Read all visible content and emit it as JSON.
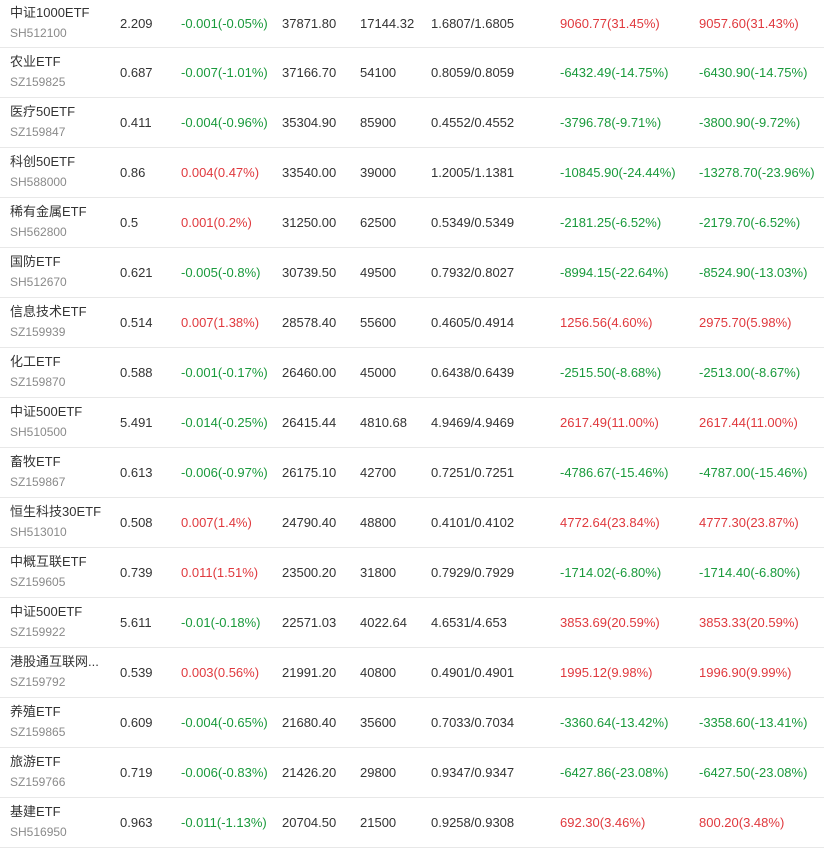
{
  "colors": {
    "up": "#e0393e",
    "down": "#1a9a3c"
  },
  "rows": [
    {
      "name": "中证1000ETF",
      "code": "SH512100",
      "price": "2.209",
      "change": "-0.001(-0.05%)",
      "change_dir": "down",
      "amount": "37871.80",
      "shares": "17144.32",
      "nav": "1.6807/1.6805",
      "pnl1": "9060.77(31.45%)",
      "pnl1_dir": "up",
      "pnl2": "9057.60(31.43%)",
      "pnl2_dir": "up"
    },
    {
      "name": "农业ETF",
      "code": "SZ159825",
      "price": "0.687",
      "change": "-0.007(-1.01%)",
      "change_dir": "down",
      "amount": "37166.70",
      "shares": "54100",
      "nav": "0.8059/0.8059",
      "pnl1": "-6432.49(-14.75%)",
      "pnl1_dir": "down",
      "pnl2": "-6430.90(-14.75%)",
      "pnl2_dir": "down"
    },
    {
      "name": "医疗50ETF",
      "code": "SZ159847",
      "price": "0.411",
      "change": "-0.004(-0.96%)",
      "change_dir": "down",
      "amount": "35304.90",
      "shares": "85900",
      "nav": "0.4552/0.4552",
      "pnl1": "-3796.78(-9.71%)",
      "pnl1_dir": "down",
      "pnl2": "-3800.90(-9.72%)",
      "pnl2_dir": "down"
    },
    {
      "name": "科创50ETF",
      "code": "SH588000",
      "price": "0.86",
      "change": "0.004(0.47%)",
      "change_dir": "up",
      "amount": "33540.00",
      "shares": "39000",
      "nav": "1.2005/1.1381",
      "pnl1": "-10845.90(-24.44%)",
      "pnl1_dir": "down",
      "pnl2": "-13278.70(-23.96%)",
      "pnl2_dir": "down"
    },
    {
      "name": "稀有金属ETF",
      "code": "SH562800",
      "price": "0.5",
      "change": "0.001(0.2%)",
      "change_dir": "up",
      "amount": "31250.00",
      "shares": "62500",
      "nav": "0.5349/0.5349",
      "pnl1": "-2181.25(-6.52%)",
      "pnl1_dir": "down",
      "pnl2": "-2179.70(-6.52%)",
      "pnl2_dir": "down"
    },
    {
      "name": "国防ETF",
      "code": "SH512670",
      "price": "0.621",
      "change": "-0.005(-0.8%)",
      "change_dir": "down",
      "amount": "30739.50",
      "shares": "49500",
      "nav": "0.7932/0.8027",
      "pnl1": "-8994.15(-22.64%)",
      "pnl1_dir": "down",
      "pnl2": "-8524.90(-13.03%)",
      "pnl2_dir": "down"
    },
    {
      "name": "信息技术ETF",
      "code": "SZ159939",
      "price": "0.514",
      "change": "0.007(1.38%)",
      "change_dir": "up",
      "amount": "28578.40",
      "shares": "55600",
      "nav": "0.4605/0.4914",
      "pnl1": "1256.56(4.60%)",
      "pnl1_dir": "up",
      "pnl2": "2975.70(5.98%)",
      "pnl2_dir": "up"
    },
    {
      "name": "化工ETF",
      "code": "SZ159870",
      "price": "0.588",
      "change": "-0.001(-0.17%)",
      "change_dir": "down",
      "amount": "26460.00",
      "shares": "45000",
      "nav": "0.6438/0.6439",
      "pnl1": "-2515.50(-8.68%)",
      "pnl1_dir": "down",
      "pnl2": "-2513.00(-8.67%)",
      "pnl2_dir": "down"
    },
    {
      "name": "中证500ETF",
      "code": "SH510500",
      "price": "5.491",
      "change": "-0.014(-0.25%)",
      "change_dir": "down",
      "amount": "26415.44",
      "shares": "4810.68",
      "nav": "4.9469/4.9469",
      "pnl1": "2617.49(11.00%)",
      "pnl1_dir": "up",
      "pnl2": "2617.44(11.00%)",
      "pnl2_dir": "up"
    },
    {
      "name": "畜牧ETF",
      "code": "SZ159867",
      "price": "0.613",
      "change": "-0.006(-0.97%)",
      "change_dir": "down",
      "amount": "26175.10",
      "shares": "42700",
      "nav": "0.7251/0.7251",
      "pnl1": "-4786.67(-15.46%)",
      "pnl1_dir": "down",
      "pnl2": "-4787.00(-15.46%)",
      "pnl2_dir": "down"
    },
    {
      "name": "恒生科技30ETF",
      "code": "SH513010",
      "price": "0.508",
      "change": "0.007(1.4%)",
      "change_dir": "up",
      "amount": "24790.40",
      "shares": "48800",
      "nav": "0.4101/0.4102",
      "pnl1": "4772.64(23.84%)",
      "pnl1_dir": "up",
      "pnl2": "4777.30(23.87%)",
      "pnl2_dir": "up"
    },
    {
      "name": "中概互联ETF",
      "code": "SZ159605",
      "price": "0.739",
      "change": "0.011(1.51%)",
      "change_dir": "up",
      "amount": "23500.20",
      "shares": "31800",
      "nav": "0.7929/0.7929",
      "pnl1": "-1714.02(-6.80%)",
      "pnl1_dir": "down",
      "pnl2": "-1714.40(-6.80%)",
      "pnl2_dir": "down"
    },
    {
      "name": "中证500ETF",
      "code": "SZ159922",
      "price": "5.611",
      "change": "-0.01(-0.18%)",
      "change_dir": "down",
      "amount": "22571.03",
      "shares": "4022.64",
      "nav": "4.6531/4.653",
      "pnl1": "3853.69(20.59%)",
      "pnl1_dir": "up",
      "pnl2": "3853.33(20.59%)",
      "pnl2_dir": "up"
    },
    {
      "name": "港股通互联网...",
      "code": "SZ159792",
      "price": "0.539",
      "change": "0.003(0.56%)",
      "change_dir": "up",
      "amount": "21991.20",
      "shares": "40800",
      "nav": "0.4901/0.4901",
      "pnl1": "1995.12(9.98%)",
      "pnl1_dir": "up",
      "pnl2": "1996.90(9.99%)",
      "pnl2_dir": "up"
    },
    {
      "name": "养殖ETF",
      "code": "SZ159865",
      "price": "0.609",
      "change": "-0.004(-0.65%)",
      "change_dir": "down",
      "amount": "21680.40",
      "shares": "35600",
      "nav": "0.7033/0.7034",
      "pnl1": "-3360.64(-13.42%)",
      "pnl1_dir": "down",
      "pnl2": "-3358.60(-13.41%)",
      "pnl2_dir": "down"
    },
    {
      "name": "旅游ETF",
      "code": "SZ159766",
      "price": "0.719",
      "change": "-0.006(-0.83%)",
      "change_dir": "down",
      "amount": "21426.20",
      "shares": "29800",
      "nav": "0.9347/0.9347",
      "pnl1": "-6427.86(-23.08%)",
      "pnl1_dir": "down",
      "pnl2": "-6427.50(-23.08%)",
      "pnl2_dir": "down"
    },
    {
      "name": "基建ETF",
      "code": "SH516950",
      "price": "0.963",
      "change": "-0.011(-1.13%)",
      "change_dir": "down",
      "amount": "20704.50",
      "shares": "21500",
      "nav": "0.9258/0.9308",
      "pnl1": "692.30(3.46%)",
      "pnl1_dir": "up",
      "pnl2": "800.20(3.48%)",
      "pnl2_dir": "up"
    }
  ]
}
